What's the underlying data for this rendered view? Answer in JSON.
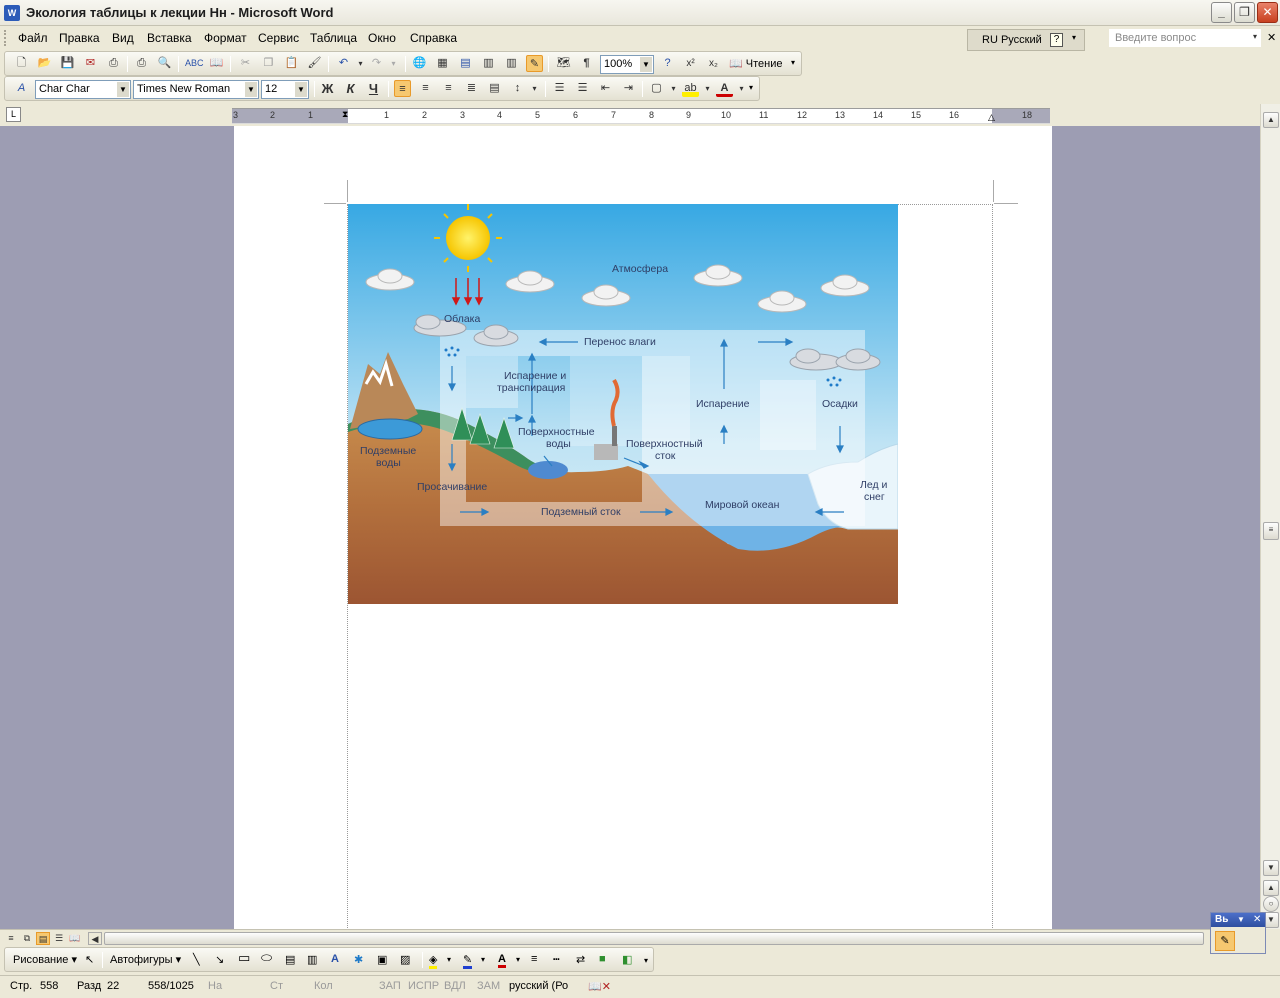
{
  "window": {
    "title": "Экология таблицы к лекции Нн - Microsoft Word"
  },
  "menu": {
    "items": [
      "Файл",
      "Правка",
      "Вид",
      "Вставка",
      "Формат",
      "Сервис",
      "Таблица",
      "Окно",
      "Справка"
    ],
    "language": "RU Русский",
    "help_placeholder": "Введите вопрос"
  },
  "toolbar_standard": {
    "zoom": "100%",
    "reading_label": "Чтение"
  },
  "toolbar_formatting": {
    "style": "Char Char",
    "font": "Times New Roman",
    "size": "12",
    "bold": "Ж",
    "italic": "К",
    "underline": "Ч"
  },
  "ruler": {
    "left_labels": [
      "3",
      "2",
      "1"
    ],
    "right_labels": [
      "1",
      "2",
      "3",
      "4",
      "5",
      "6",
      "7",
      "8",
      "9",
      "10",
      "11",
      "12",
      "13",
      "14",
      "15",
      "16",
      "18"
    ]
  },
  "diagram": {
    "labels": {
      "atmosphere": "Атмосфера",
      "clouds": "Облака",
      "moisture_transfer": "Перенос влаги",
      "evapotranspiration_1": "Испарение и",
      "evapotranspiration_2": "транспирация",
      "evaporation": "Испарение",
      "precipitation": "Осадки",
      "surface_water_1": "Поверхностные",
      "surface_water_2": "воды",
      "surface_runoff_1": "Поверхностный",
      "surface_runoff_2": "сток",
      "groundwater_1": "Подземные",
      "groundwater_2": "воды",
      "infiltration": "Просачивание",
      "underground_runoff": "Подземный сток",
      "world_ocean": "Мировой океан",
      "ice_snow_1": "Лед и",
      "ice_snow_2": "снег"
    }
  },
  "drawing_toolbar": {
    "draw_label": "Рисование",
    "autoshapes_label": "Автофигуры"
  },
  "statusbar": {
    "page": "Стр.",
    "page_num": "558",
    "section_label": "Разд",
    "section_num": "22",
    "page_of": "558/1025",
    "at": "На",
    "line": "Ст",
    "col": "Кол",
    "rec": "ЗАП",
    "trk": "ИСПР",
    "ext": "ВДЛ",
    "ovr": "ЗАМ",
    "language": "русский (Ро"
  },
  "floatbar": {
    "title": "Вь"
  }
}
